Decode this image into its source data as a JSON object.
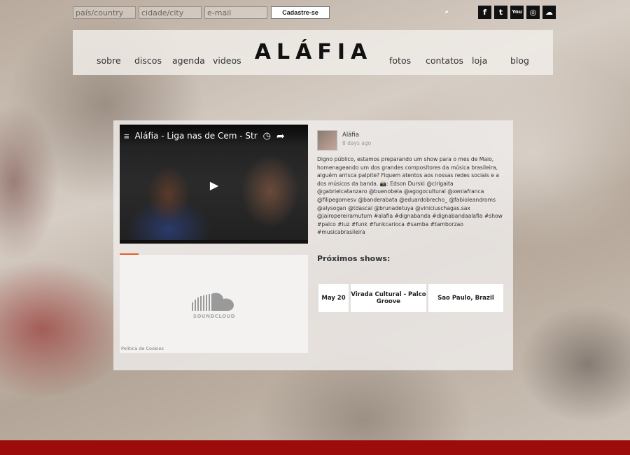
{
  "signup": {
    "country_placeholder": "país/country",
    "city_placeholder": "cidade/city",
    "email_placeholder": "e-mail",
    "submit_label": "Cadastre-se"
  },
  "social": {
    "icons": [
      "facebook-icon",
      "twitter-icon",
      "youtube-icon",
      "instagram-icon",
      "soundcloud-icon"
    ],
    "glyphs": [
      "f",
      "t",
      "You",
      "◎",
      "☁"
    ]
  },
  "nav": {
    "logo": "ALÁFIA",
    "items": [
      "sobre",
      "discos",
      "agenda",
      "videos",
      "fotos",
      "contatos",
      "loja",
      "blog"
    ]
  },
  "video": {
    "title": "Aláfia - Liga nas de Cem - Str..."
  },
  "soundcloud": {
    "brand": "SOUNDCLOUD",
    "cookies_link": "Politica de Cookies"
  },
  "post": {
    "author": "Aláfia",
    "time": "8 days ago",
    "text": "Digno público, estamos preparando um show para o mes de Maio, homenageando um dos grandes compositores da música brasileira, alguém arrisca palpite? Fiquem atentos aos nossas redes sociais e a dos músicos da banda. 📸: Edson Durski @cirigaita @gabrielcatanzaro @buenobela @agogocultural @xeniafranca @filipegomesv @banderabata @eduardobrecho_ @fabioleandroms @alysogan @tdascal @brunadetuya @viniciuschagas.sax @jairopereiramutum #alafia #dignabanda #dignabandaalafia #show #palco #luz #funk #funkcarioca #samba #tamborzao #musicabrasileira"
  },
  "shows": {
    "title": "Próximos shows:",
    "rows": [
      {
        "date": "May 20",
        "event": "Virada Cultural - Palco Groove",
        "place": "Sao Paulo, Brazil"
      }
    ]
  },
  "colors": {
    "footer_bar": "#9b0c0b",
    "accent": "#e06030"
  }
}
